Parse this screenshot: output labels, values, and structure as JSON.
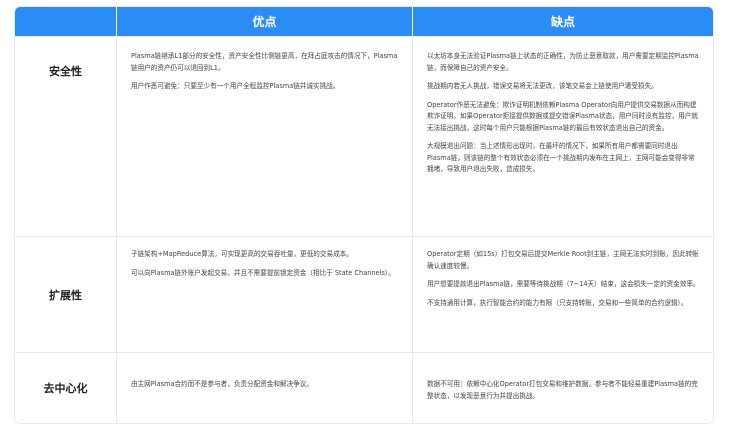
{
  "header": {
    "col_aspect": "",
    "col_pros": "优点",
    "col_cons": "缺点"
  },
  "rows": [
    {
      "aspect": "安全性",
      "pros": [
        "Plasma链继承L1部分的安全性，资产安全性比侧链更高，在拜占庭攻击的情况下，Plasma链用户的资产仍可以退回到L1。",
        "用户作恶可避免：只要至少有一个用户全程监控Plasma链并诚实挑战。"
      ],
      "cons": [
        "以太坊本身无法验证Plasma链上状态的正确性，为防止恶意取款，用户需要定期监控Plasma链，而保障自己的资产安全。",
        "挑战期内若无人挑战，错误交易将无法更改，该笔交易会上链使用户遭受损失。",
        "Operator作恶无法避免：欺诈证明机制依赖Plasma Operator向用户提供交易数据从而构建欺诈证明。如果Operator拒接提供数据或提交错误Plasma状态，用户同时没有监控，用户就无法接出挑战，这时每个用户只能根据Plasma链的最后有效状态退出自己的资金。",
        "大规模退出问题：当上述情形出现时，在最坏的情况下，如果所有用户都需要同时退出Plasma链，则该链的整个有效状态必须在一个挑战期内发布在主网上，主网可能会变得非常拥堵，导致用户退出失败，造成损失。"
      ]
    },
    {
      "aspect": "扩展性",
      "pros": [
        "子链架构+MapReduce算法，可实现更高的交易吞吐量，更低的交易成本。",
        "可以向Plasma链外账户发起交易，并且不需要提前锁定资金（相比于 State Channels）。"
      ],
      "cons": [
        "Operator定期（如15s）打包交易后提交Merkle Root到主链，主网无法实时到账，因此转账确认速度较慢。",
        "用户想要提款退出Plasma链，需要等待挑战期（7~14天）结束，这会损失一定的资金效率。",
        "不支持通用计算，执行智能合约的能力有限（只支持转账，交易和一些简单的合约逻辑）。"
      ]
    },
    {
      "aspect": "去中心化",
      "pros": [
        "由主网Plasma合约而不是参与者，负责分配资金和解决争议。"
      ],
      "cons": [
        "数据不可用：依赖中心化Operator打包交易和维护数据，参与者不能轻易重建Plasma链的完整状态，以发现恶意行为并提出挑战。"
      ]
    }
  ],
  "colors": {
    "header_bg": "#2b8cf6",
    "header_text": "#ffffff",
    "border": "#e4e9f0"
  }
}
